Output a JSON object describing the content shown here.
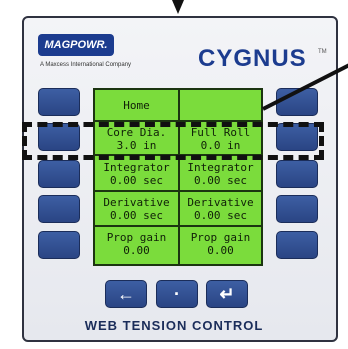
{
  "brand": {
    "name": "MAGPOWR.",
    "subtitle": "A Maxcess International Company"
  },
  "product": {
    "name": "CYGNUS",
    "tm": "TM"
  },
  "lcd": {
    "header": {
      "left": "Home",
      "right": ""
    },
    "rows": [
      {
        "left_label": "Core Dia.",
        "left_value": "3.0 in",
        "right_label": "Full Roll",
        "right_value": "0.0 in"
      },
      {
        "left_label": "Integrator",
        "left_value": "0.00 sec",
        "right_label": "Integrator",
        "right_value": "0.00 sec"
      },
      {
        "left_label": "Derivative",
        "left_value": "0.00 sec",
        "right_label": "Derivative",
        "right_value": "0.00 sec"
      },
      {
        "left_label": "Prop gain",
        "left_value": "0.00",
        "right_label": "Prop gain",
        "right_value": "0.00"
      }
    ]
  },
  "nav": {
    "left": "←",
    "center": "·",
    "enter": "↵"
  },
  "footer": "WEB TENSION CONTROL"
}
